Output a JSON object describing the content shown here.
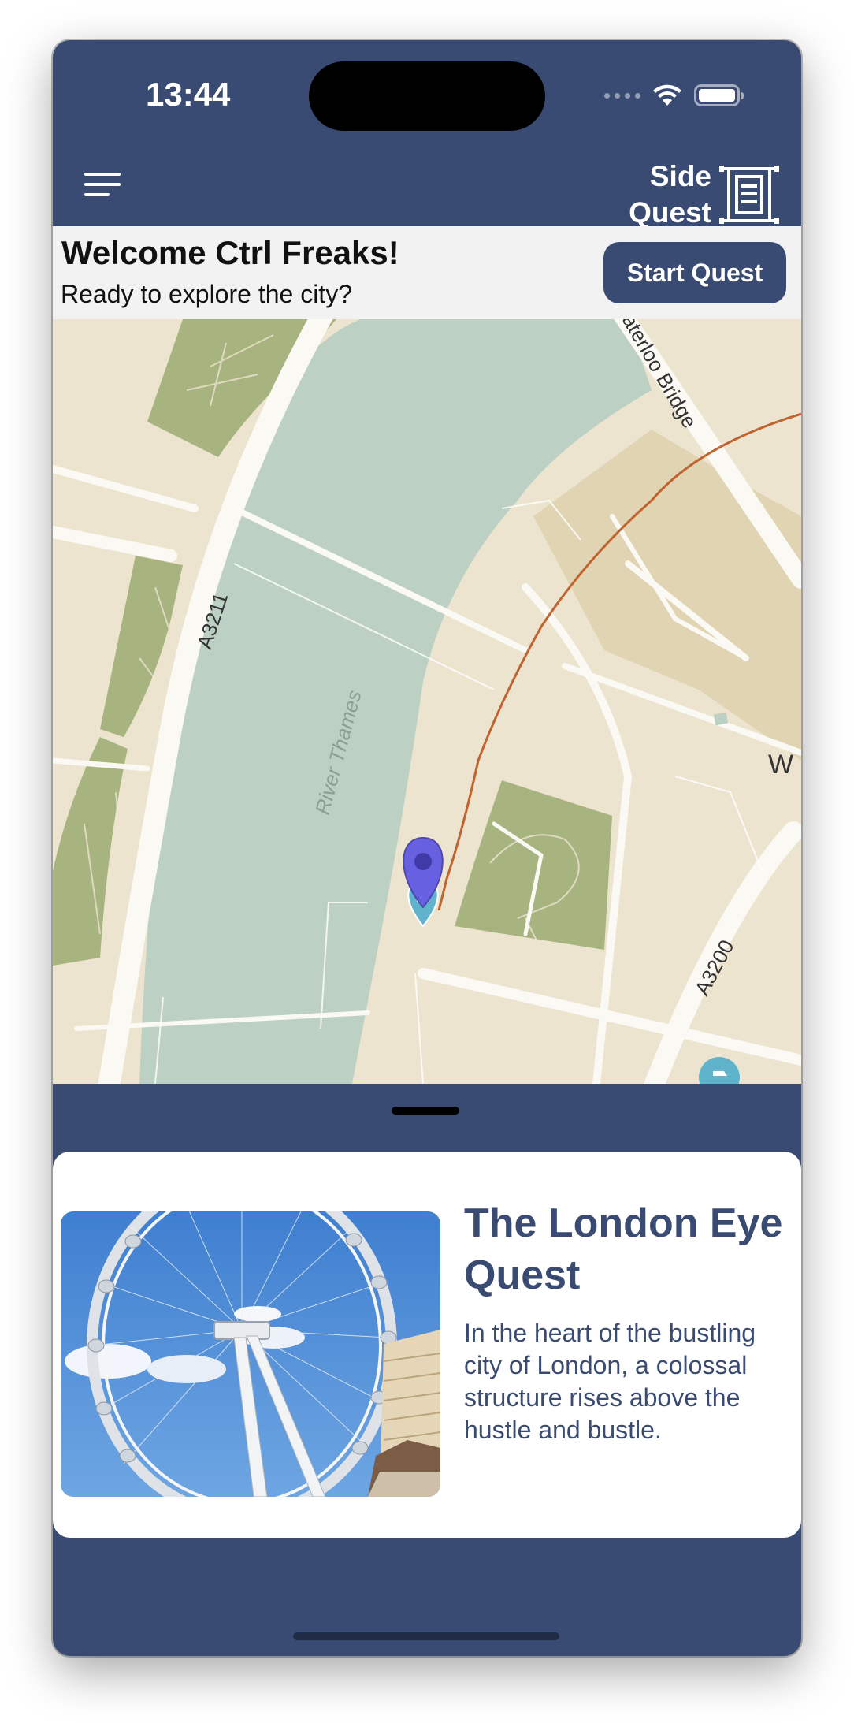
{
  "status_bar": {
    "time": "13:44"
  },
  "header": {
    "brand_line1": "Side",
    "brand_line2": "Quest"
  },
  "welcome": {
    "title": "Welcome Ctrl Freaks!",
    "subtitle": "Ready to explore the city?",
    "start_button": "Start Quest"
  },
  "map": {
    "labels": {
      "river": "River Thames",
      "road_a3211": "A3211",
      "bridge": "aterloo Bridge",
      "road_a3200": "A3200",
      "edge_letter": "W"
    }
  },
  "quest_card": {
    "title": "The London Eye Quest",
    "description": "In the heart of the bustling city of London, a colossal structure rises above the hustle and bustle."
  },
  "colors": {
    "primary": "#3a4b73",
    "water": "#bcd1c4",
    "park": "#a7b47f",
    "land": "#ede4d0",
    "route": "#c0632f",
    "pin": "#6760e0"
  },
  "icons": [
    "menu-icon",
    "quest-scroll-icon",
    "wifi-icon",
    "battery-icon",
    "map-pin-icon",
    "location-marker-icon",
    "poi-icon"
  ]
}
